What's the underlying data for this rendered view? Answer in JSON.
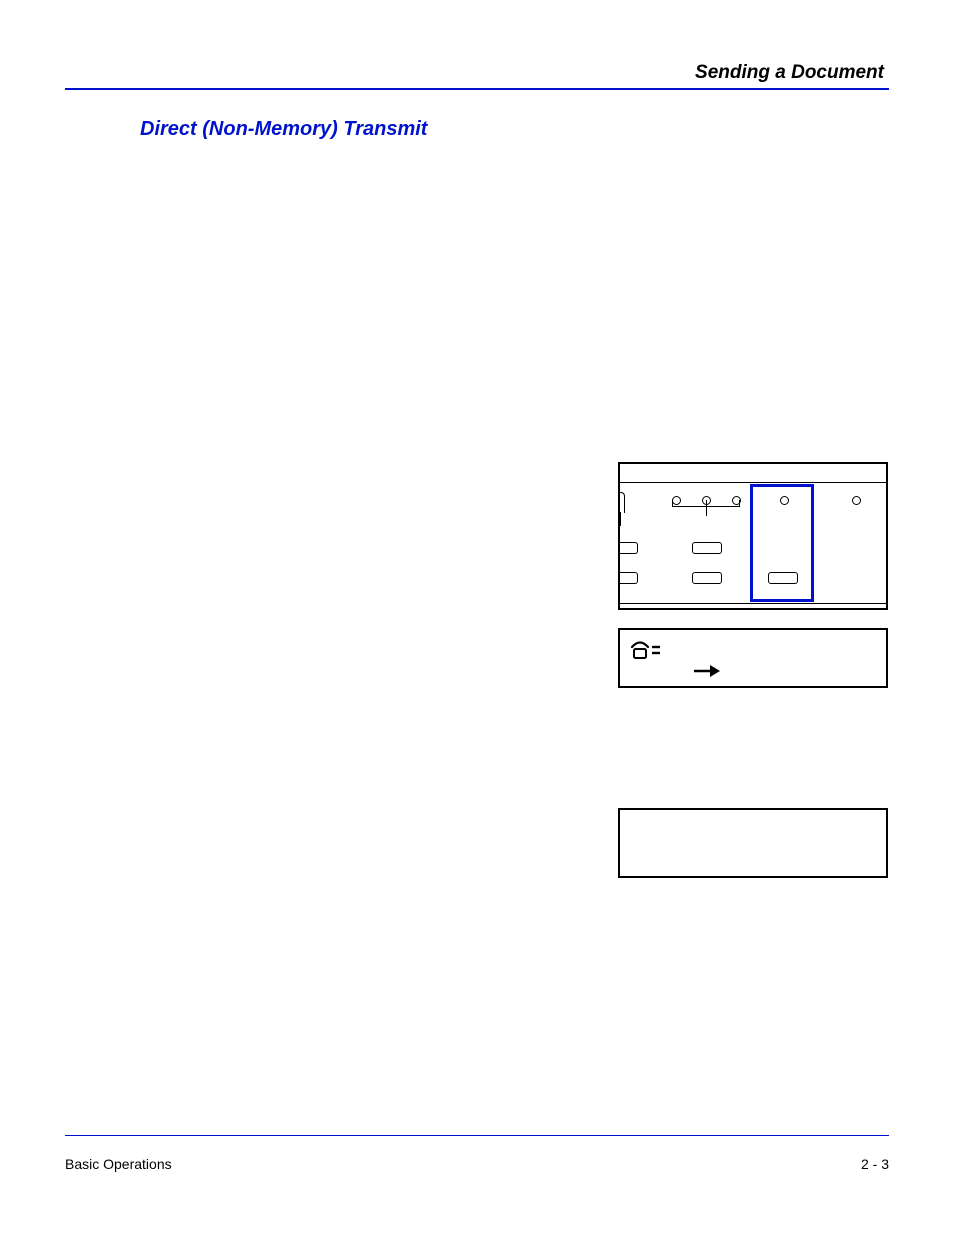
{
  "header": {
    "chapter_title": "Sending a Document"
  },
  "section": {
    "title": "Direct (Non-Memory) Transmit"
  },
  "lcd1": {
    "phone_label": "=",
    "arrow": "→"
  },
  "footer": {
    "left": "Basic Operations",
    "right": "2 - 3"
  }
}
